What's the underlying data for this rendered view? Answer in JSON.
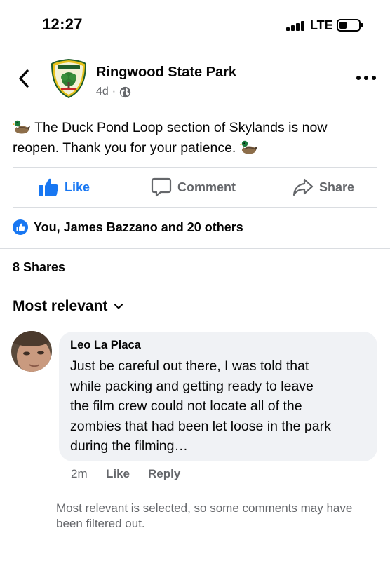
{
  "status_bar": {
    "time": "12:27",
    "carrier": "LTE"
  },
  "post": {
    "page_name": "Ringwood State Park",
    "age": "4d",
    "separator": "·",
    "audience_icon": "globe-icon",
    "text_line1": "The Duck Pond Loop section of Skylands is now",
    "text_line2": "reopen. Thank you for your patience."
  },
  "actions": {
    "like": "Like",
    "comment": "Comment",
    "share": "Share"
  },
  "reactions": {
    "summary": "You, James Bazzano and 20 others"
  },
  "shares": {
    "label": "8 Shares"
  },
  "comments_sort": {
    "label": "Most relevant"
  },
  "comment": {
    "author": "Leo La Placa",
    "lines": [
      "Just be careful out there, I was told that",
      "while packing and getting ready to leave",
      "the film crew could not locate all of the",
      "zombies that had been let loose in the park",
      "during the filming…"
    ],
    "age": "2m",
    "like": "Like",
    "reply": "Reply"
  },
  "filter_note": "Most relevant is selected, so some comments may have been filtered out.",
  "colors": {
    "accent": "#1877f2",
    "secondary_text": "#65676b",
    "bubble": "#f0f2f5"
  }
}
